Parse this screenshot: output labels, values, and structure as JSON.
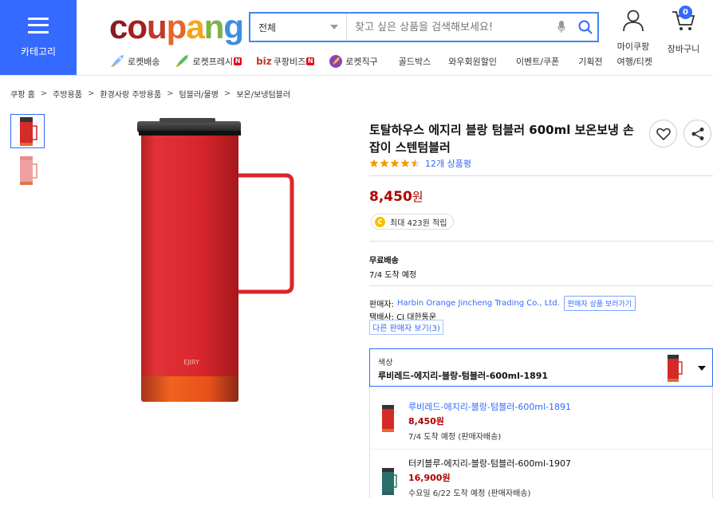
{
  "header": {
    "category_label": "카테고리",
    "logo": {
      "c": "c",
      "o": "o",
      "u": "u",
      "p": "p",
      "a": "a",
      "n": "n",
      "g": "g"
    },
    "search": {
      "category_selected": "전체",
      "placeholder": "찾고 싶은 상품을 검색해보세요!"
    },
    "mypage_label": "마이쿠팡",
    "cart_label": "장바구니",
    "cart_count": "0"
  },
  "nav": [
    {
      "label": "로켓배송",
      "icon": "rocket-icon",
      "new": false
    },
    {
      "label": "로켓프레시",
      "icon": "rocket-fresh-icon",
      "new": true
    },
    {
      "label": "쿠팡비즈",
      "icon": "biz-icon",
      "prefix": "biz",
      "new": true
    },
    {
      "label": "로켓직구",
      "icon": "rocket-global-icon",
      "new": false
    },
    {
      "label": "골드박스",
      "new": false
    },
    {
      "label": "와우회원할인",
      "new": false
    },
    {
      "label": "이벤트/쿠폰",
      "new": false
    },
    {
      "label": "기획전",
      "new": false
    },
    {
      "label": "여행/티켓",
      "new": false
    }
  ],
  "new_badge": "N",
  "breadcrumb": [
    "쿠팡 홈",
    "주방용품",
    "환경사랑 주방용품",
    "텀블러/물병",
    "보온/보냉텀블러"
  ],
  "breadcrumb_sep": ">",
  "product": {
    "title": "토탈하우스 에지리 블랑 텀블러 600ml 보온보냉 손잡이 스텐텀블러",
    "rating": 4.5,
    "review_count_text": "12개 상품평",
    "price": "8,450",
    "price_unit": "원",
    "cashback_icon": "C",
    "cashback_text": "최대 423원 적립",
    "shipping_title": "무료배송",
    "shipping_eta": "7/4 도착 예정",
    "seller_label": "판매자:",
    "seller_name": "Harbin Orange Jincheng Trading Co., Ltd.",
    "seller_button": "판매자 상품 보러가기",
    "courier_label": "택배사:",
    "courier_name": "CJ 대한통운",
    "other_sellers": "다른 판매자 보기(3)",
    "brand_mark": "EJIRY"
  },
  "option": {
    "label": "색상",
    "selected": "루비레드-에지리-블랑-텀블러-600ml-1891",
    "items": [
      {
        "name": "루비레드-에지리-블랑-텀블러-600ml-1891",
        "price": "8,450원",
        "delivery": "7/4 도착 예정 (판매자배송)",
        "color": "#d91c24"
      },
      {
        "name": "터키블루-에지리-블랑-텀블러-600ml-1907",
        "price": "16,900원",
        "delivery": "수요일 6/22 도착 예정 (판매자배송)",
        "color": "#2a6e6a"
      }
    ]
  },
  "colors": {
    "accent": "#346aff",
    "price": "#ae0000",
    "logo_c": "#8b1c1c",
    "logo_o": "#e63e2b",
    "logo_u": "#f5a623",
    "logo_p": "#7bb342",
    "logo_a": "#e6a417",
    "logo_n": "#4aa1dc",
    "logo_g": "#3d8ee0"
  }
}
